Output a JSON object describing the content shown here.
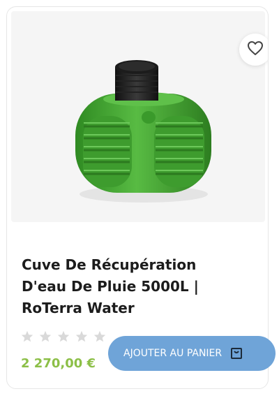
{
  "product": {
    "title": "Cuve De Récupération D'eau De Pluie 5000L | RoTerra Water",
    "price": "2 270,00 €",
    "rating": {
      "value": 0,
      "max": 5
    },
    "add_to_cart_label": "AJOUTER AU PANIER"
  },
  "icons": {
    "wishlist": "heart-outline-icon",
    "cart": "shopping-bag-icon",
    "rating": "star-icon"
  },
  "colors": {
    "price": "#8cbf47",
    "button": "#6fa4d8",
    "tank_green": "#4cae3a",
    "star_empty": "#d9d9d9"
  }
}
